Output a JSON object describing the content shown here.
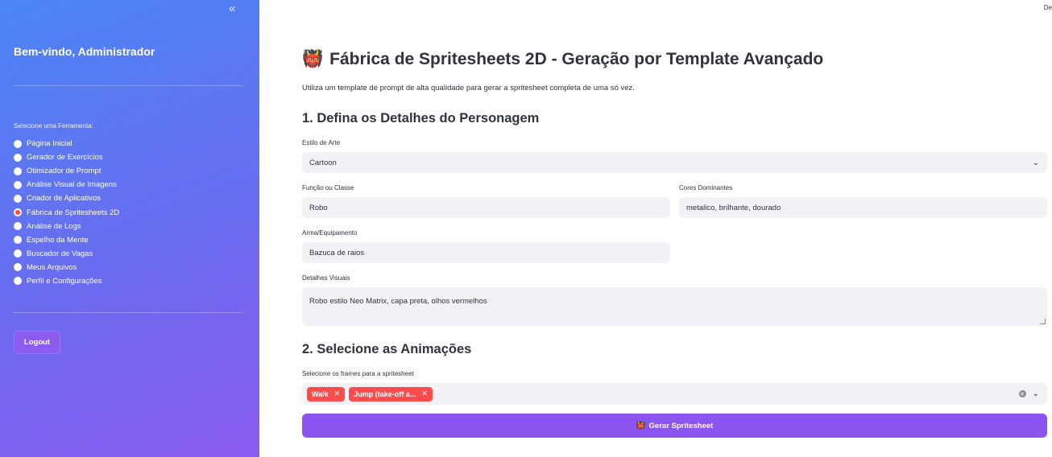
{
  "sidebar": {
    "collapse_icon": "«",
    "welcome": "Bem-vindo, Administrador",
    "tool_label": "Selecione uma Ferramenta:",
    "items": [
      {
        "label": "Página Inicial",
        "selected": false
      },
      {
        "label": "Gerador de Exercícios",
        "selected": false
      },
      {
        "label": "Otimizador de Prompt",
        "selected": false
      },
      {
        "label": "Análise Visual de Imagens",
        "selected": false
      },
      {
        "label": "Criador de Aplicativos",
        "selected": false
      },
      {
        "label": "Fábrica de Spritesheets 2D",
        "selected": true
      },
      {
        "label": "Análise de Logs",
        "selected": false
      },
      {
        "label": "Espelho da Mente",
        "selected": false
      },
      {
        "label": "Buscador de Vagas",
        "selected": false
      },
      {
        "label": "Meus Arquivos",
        "selected": false
      },
      {
        "label": "Perfil e Configurações",
        "selected": false
      }
    ],
    "logout_label": "Logout"
  },
  "header": {
    "top_right": "De"
  },
  "main": {
    "title_emoji": "👹",
    "title": "Fábrica de Spritesheets 2D - Geração por Template Avançado",
    "subtitle": "Utiliza um template de prompt de alta qualidade para gerar a spritesheet completa de uma só vez.",
    "section1": "1. Defina os Detalhes do Personagem",
    "art_style": {
      "label": "Estilo de Arte",
      "value": "Cartoon"
    },
    "function": {
      "label": "Função ou Classe",
      "value": "Robo"
    },
    "colors": {
      "label": "Cores Dominantes",
      "value": "metalico, brilhante, dourado"
    },
    "weapon": {
      "label": "Arma/Equipamento",
      "value": "Bazuca de raios"
    },
    "details": {
      "label": "Detalhes Visuais",
      "value": "Robo estilo Neo Matrix, capa preta, olhos vermelhos"
    },
    "section2": "2. Selecione as Animações",
    "frames": {
      "label": "Selecione os frames para a spritesheet",
      "tags": [
        "Walk",
        "Jump (take-off a..."
      ]
    },
    "generate_emoji": "👹",
    "generate_label": "Gerar Spritesheet"
  },
  "colors": {
    "accent": "#ff4b4b",
    "button": "#8c55f2",
    "input_bg": "#f0f2f6"
  }
}
